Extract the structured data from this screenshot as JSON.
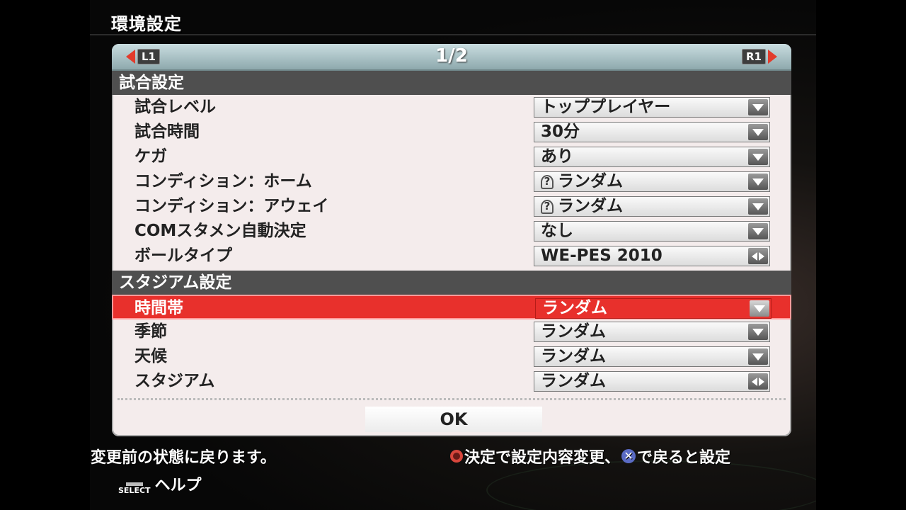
{
  "screen": {
    "title": "環境設定"
  },
  "pager": {
    "text": "1/2",
    "left_button": "L1",
    "right_button": "R1"
  },
  "sections": [
    {
      "title": "試合設定"
    },
    {
      "title": "スタジアム設定"
    }
  ],
  "match_settings": [
    {
      "label": "試合レベル",
      "value": "トッププレイヤー",
      "control": "dropdown"
    },
    {
      "label": "試合時間",
      "value": "30分",
      "control": "dropdown"
    },
    {
      "label": "ケガ",
      "value": "あり",
      "control": "dropdown"
    },
    {
      "label": "コンディション：ホーム",
      "value": "ランダム",
      "control": "dropdown",
      "icon": "condition-icon"
    },
    {
      "label": "コンディション：アウェイ",
      "value": "ランダム",
      "control": "dropdown",
      "icon": "condition-icon"
    },
    {
      "label": "COMスタメン自動決定",
      "value": "なし",
      "control": "dropdown"
    },
    {
      "label": "ボールタイプ",
      "value": "WE-PES 2010",
      "control": "selector"
    }
  ],
  "stadium_settings": [
    {
      "label": "時間帯",
      "value": "ランダム",
      "control": "dropdown",
      "selected": true
    },
    {
      "label": "季節",
      "value": "ランダム",
      "control": "dropdown"
    },
    {
      "label": "天候",
      "value": "ランダム",
      "control": "dropdown"
    },
    {
      "label": "スタジアム",
      "value": "ランダム",
      "control": "selector"
    }
  ],
  "ok_button": "OK",
  "help": {
    "description": "変更前の状態に戻ります。",
    "hint_confirm": "決定で設定内容変更、",
    "hint_back": "で戻ると設定",
    "select_chip": "SELECT",
    "select_label": "ヘルプ"
  },
  "colors": {
    "selected_row": "#e8302c",
    "section_bar": "#4f4f4f",
    "panel": "#f4ecec",
    "pager": "#9fb8bc"
  }
}
